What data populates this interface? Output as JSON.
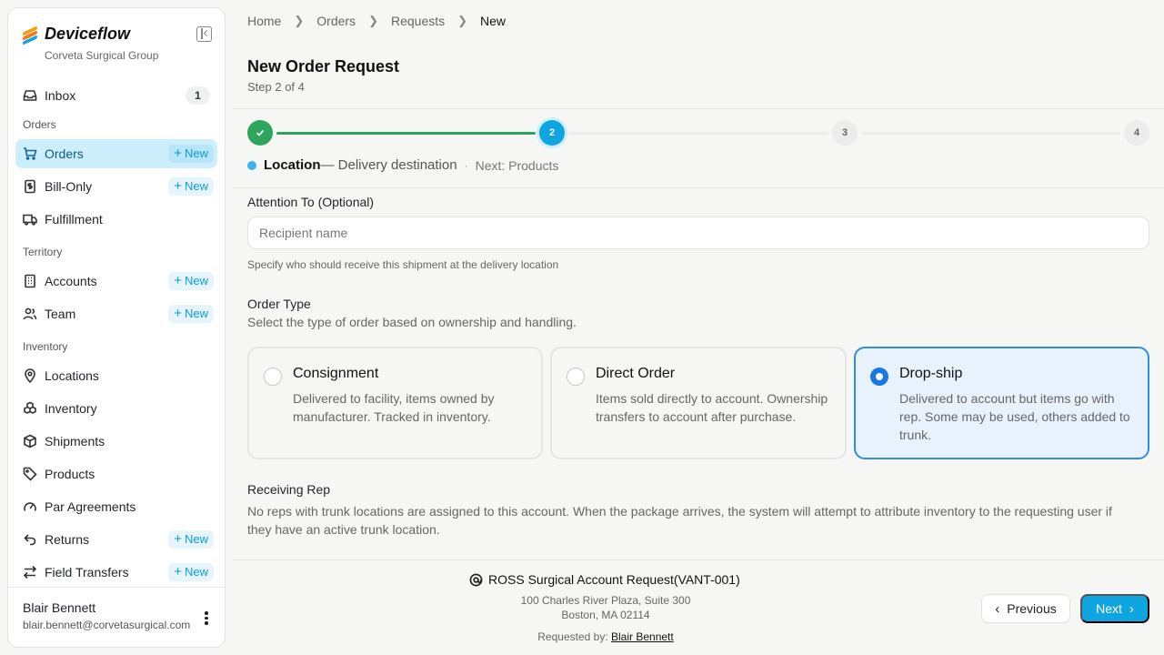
{
  "app": {
    "name": "Deviceflow",
    "org": "Corveta Surgical Group"
  },
  "colors": {
    "accent": "#0ea5e0",
    "success": "#2ea55d",
    "selected_border": "#2f8de4"
  },
  "sidebar": {
    "inbox": {
      "label": "Inbox",
      "count": "1",
      "icon": "inbox-icon"
    },
    "sections": {
      "orders": "Orders",
      "territory": "Territory",
      "inventory": "Inventory"
    },
    "items": [
      {
        "label": "Orders",
        "new": "New",
        "icon": "cart-icon",
        "active": true
      },
      {
        "label": "Bill-Only",
        "new": "New",
        "icon": "receipt-icon"
      },
      {
        "label": "Fulfillment",
        "icon": "truck-icon"
      },
      {
        "label": "Accounts",
        "new": "New",
        "icon": "building-icon"
      },
      {
        "label": "Team",
        "new": "New",
        "icon": "users-icon"
      },
      {
        "label": "Locations",
        "icon": "pin-icon"
      },
      {
        "label": "Inventory",
        "icon": "boxes-icon"
      },
      {
        "label": "Shipments",
        "icon": "package-icon"
      },
      {
        "label": "Products",
        "icon": "tag-icon"
      },
      {
        "label": "Par Agreements",
        "icon": "gauge-icon"
      },
      {
        "label": "Returns",
        "new": "New",
        "icon": "return-icon"
      },
      {
        "label": "Field Transfers",
        "new": "New",
        "icon": "transfer-icon"
      }
    ],
    "user": {
      "name": "Blair Bennett",
      "email": "blair.bennett@corvetasurgical.com"
    }
  },
  "breadcrumb": [
    "Home",
    "Orders",
    "Requests",
    "New"
  ],
  "page": {
    "title": "New Order Request",
    "subtitle": "Step 2 of 4"
  },
  "stepper": {
    "steps": [
      "1",
      "2",
      "3",
      "4"
    ],
    "current_step": 2,
    "current_title": "Location",
    "current_desc": "— Delivery destination",
    "separator": "·",
    "next": "Next: Products"
  },
  "form": {
    "attention": {
      "label": "Attention To (Optional)",
      "placeholder": "Recipient name",
      "value": "",
      "hint": "Specify who should receive this shipment at the delivery location"
    },
    "order_type": {
      "label": "Order Type",
      "description": "Select the type of order based on ownership and handling.",
      "selected": "Drop-ship",
      "options": [
        {
          "title": "Consignment",
          "desc": "Delivered to facility, items owned by manufacturer. Tracked in inventory."
        },
        {
          "title": "Direct Order",
          "desc": "Items sold directly to account. Ownership transfers to account after purchase."
        },
        {
          "title": "Drop-ship",
          "desc": "Delivered to account but items go with rep. Some may be used, others added to trunk."
        }
      ]
    },
    "receiving_rep": {
      "label": "Receiving Rep",
      "description": "No reps with trunk locations are assigned to this account. When the package arrives, the system will attempt to attribute inventory to the requesting user if they have an active trunk location."
    }
  },
  "footer": {
    "account": "ROSS Surgical Account Request(VANT-001)",
    "address_line1": "100 Charles River Plaza, Suite 300",
    "address_line2": "Boston, MA 02114",
    "requested_by_label": "Requested by:",
    "requested_by": "Blair Bennett",
    "prev": "Previous",
    "next": "Next"
  }
}
